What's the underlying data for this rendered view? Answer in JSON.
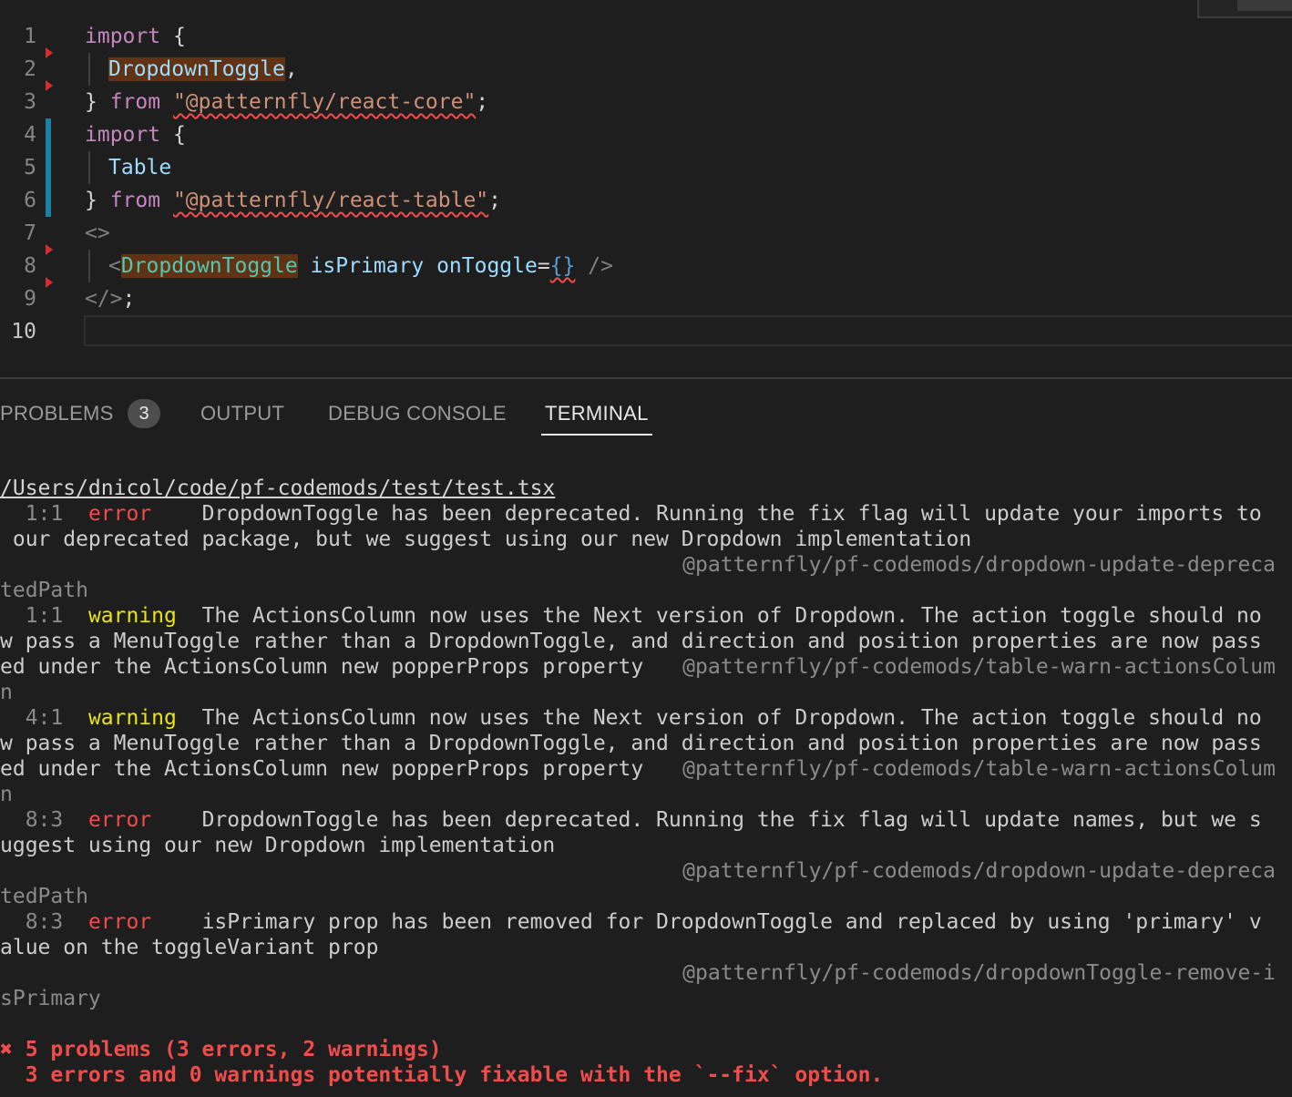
{
  "editor": {
    "line_numbers": [
      "1",
      "2",
      "3",
      "4",
      "5",
      "6",
      "7",
      "8",
      "9",
      "10"
    ],
    "l1": {
      "kw": "import",
      "p": " {"
    },
    "l2": {
      "name": "DropdownToggle",
      "p": ","
    },
    "l3": {
      "p1": "} ",
      "kw": "from",
      "sp": " ",
      "str": "\"@patternfly/react-core\"",
      "p2": ";"
    },
    "l4": {
      "kw": "import",
      "p": " {"
    },
    "l5": {
      "name": "Table"
    },
    "l6": {
      "p1": "} ",
      "kw": "from",
      "sp": " ",
      "str": "\"@patternfly/react-table\"",
      "p2": ";"
    },
    "l7": {
      "tag": "<>"
    },
    "l8": {
      "lt": "<",
      "comp": "DropdownToggle",
      "attr1": " isPrimary",
      "attr2": " onToggle",
      "eq": "=",
      "br": "{}",
      "end": " />"
    },
    "l9": {
      "tag": "</>",
      "p": ";"
    }
  },
  "panel": {
    "tabs": [
      {
        "label": "PROBLEMS",
        "badge": "3"
      },
      {
        "label": "OUTPUT"
      },
      {
        "label": "DEBUG CONSOLE"
      },
      {
        "label": "TERMINAL",
        "active": true
      }
    ]
  },
  "terminal": {
    "file_path": "/Users/dnicol/code/pf-codemods/test/test.tsx",
    "problems": [
      {
        "loc": "  1:1  ",
        "severity": "error",
        "sev_pad": "error    ",
        "lines": [
          "DropdownToggle has been deprecated. Running the fix flag will update your imports to",
          " our deprecated package, but we suggest using our new Dropdown implementation"
        ],
        "rule": "@patternfly/pf-codemods/dropdown-update-depreca",
        "rule_wrap": "tedPath"
      },
      {
        "loc": "  1:1  ",
        "severity": "warning",
        "sev_pad": "warning  ",
        "lines": [
          "The ActionsColumn now uses the Next version of Dropdown. The action toggle should no",
          "w pass a MenuToggle rather than a DropdownToggle, and direction and position properties are now pass",
          "ed under the ActionsColumn new popperProps property"
        ],
        "rule": "@patternfly/pf-codemods/table-warn-actionsColum",
        "rule_wrap": "n"
      },
      {
        "loc": "  4:1  ",
        "severity": "warning",
        "sev_pad": "warning  ",
        "lines": [
          "The ActionsColumn now uses the Next version of Dropdown. The action toggle should no",
          "w pass a MenuToggle rather than a DropdownToggle, and direction and position properties are now pass",
          "ed under the ActionsColumn new popperProps property"
        ],
        "rule": "@patternfly/pf-codemods/table-warn-actionsColum",
        "rule_wrap": "n"
      },
      {
        "loc": "  8:3  ",
        "severity": "error",
        "sev_pad": "error    ",
        "lines": [
          "DropdownToggle has been deprecated. Running the fix flag will update names, but we s",
          "uggest using our new Dropdown implementation"
        ],
        "rule": "@patternfly/pf-codemods/dropdown-update-depreca",
        "rule_wrap": "tedPath"
      },
      {
        "loc": "  8:3  ",
        "severity": "error",
        "sev_pad": "error    ",
        "lines": [
          "isPrimary prop has been removed for DropdownToggle and replaced by using 'primary' v",
          "alue on the toggleVariant prop"
        ],
        "rule": "@patternfly/pf-codemods/dropdownToggle-remove-i",
        "rule_wrap": "sPrimary"
      }
    ],
    "summary": "✖ 5 problems (3 errors, 2 warnings)",
    "fixable": "  3 errors and 0 warnings potentially fixable with the `--fix` option."
  },
  "colors": {
    "keyword": "#c586c0",
    "identifier": "#9cdcfe",
    "component": "#4ec9b0",
    "string": "#ce9178",
    "error": "#f14c4c",
    "warning": "#e5e510",
    "modified_gutter": "#1b81a8"
  }
}
